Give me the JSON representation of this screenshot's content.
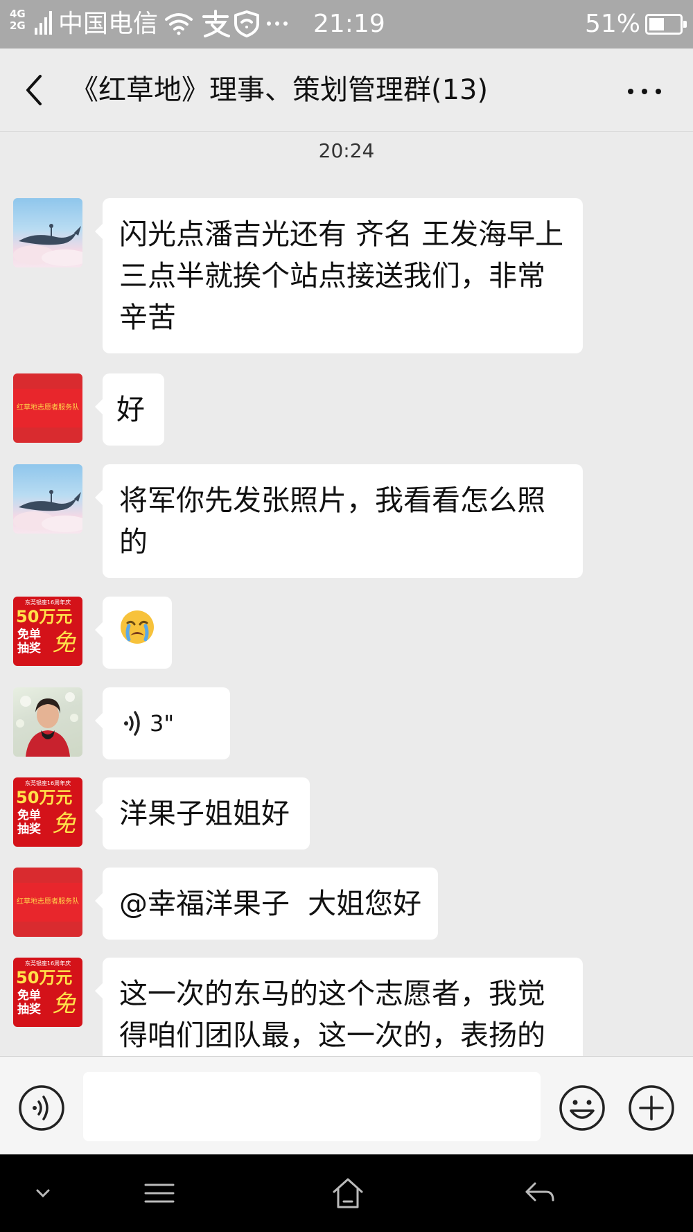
{
  "status_bar": {
    "network_top": "4G",
    "network_bottom": "2G",
    "carrier": "中国电信",
    "time": "21:19",
    "battery": "51%",
    "battery_level": 0.51
  },
  "header": {
    "title": "《红草地》理事、策划管理群(13)"
  },
  "chat": {
    "timestamp": "20:24",
    "messages": [
      {
        "avatar": "whale-avatar",
        "text": "闪光点潘吉光还有  齐名  王发海早上三点半就挨个站点接送我们，非常辛苦"
      },
      {
        "avatar": "red-banner-avatar",
        "text": "好"
      },
      {
        "avatar": "whale-avatar",
        "text": "将军你先发张照片，我看看怎么照的"
      },
      {
        "avatar": "promo-avatar",
        "emoji": "😭"
      },
      {
        "avatar": "woman-photo-avatar",
        "voice_duration": "3\""
      },
      {
        "avatar": "promo-avatar",
        "text": "洋果子姐姐好"
      },
      {
        "avatar": "red-banner-avatar",
        "text": "@幸福洋果子  大姐您好"
      },
      {
        "avatar": "promo-avatar",
        "text": "这一次的东马的这个志愿者，我觉得咱们团队最，这一次的，表扬的"
      }
    ]
  },
  "avatars": {
    "banner_text": "红草地志愿者服务队",
    "promo_line1": "东莞银座16周年庆",
    "promo_line2": "50万元",
    "promo_line3": "免单",
    "promo_line4": "抽奖",
    "promo_stamp": "免"
  },
  "input": {
    "value": "",
    "placeholder": ""
  },
  "colors": {
    "status_bar": "#a9a9a9",
    "background": "#ebebeb",
    "bubble": "#ffffff",
    "nav_bar": "#000000"
  }
}
